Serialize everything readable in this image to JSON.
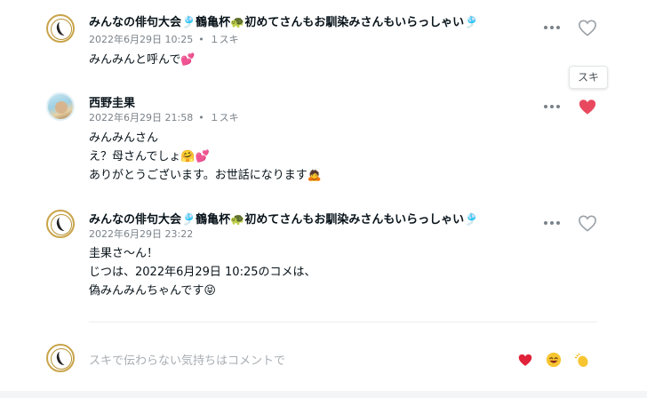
{
  "comments": [
    {
      "author": "みんなの俳句大会🎐鶴亀杯🐢初めてさんもお馴染みさんもいらっしゃい🎐",
      "date": "2022年6月29日 10:25",
      "likes": "１スキ",
      "lines": [
        "みんみんと呼んで💕"
      ],
      "liked": false
    },
    {
      "author": "西野圭果",
      "date": "2022年6月29日 21:58",
      "likes": "１スキ",
      "lines": [
        "みんみんさん",
        "え？母さんでしょ🤗💕",
        "ありがとうございます。お世話になります🙇"
      ],
      "liked": true
    },
    {
      "author": "みんなの俳句大会🎐鶴亀杯🐢初めてさんもお馴染みさんもいらっしゃい🎐",
      "date": "2022年6月29日 23:22",
      "lines": [
        "圭果さ〜ん！",
        "じつは、2022年6月29日 10:25のコメは、",
        "偽みんみんちゃんです😝"
      ],
      "liked": false
    }
  ],
  "tooltip": "スキ",
  "composer": {
    "placeholder": "スキで伝わらない気持ちはコメントで",
    "reactions": [
      "heart-reaction",
      "laugh-reaction",
      "clap-reaction"
    ]
  },
  "colors": {
    "heart_active": "#e8495f",
    "heart_outline": "#9aa1a7",
    "meta": "#7a8289"
  }
}
